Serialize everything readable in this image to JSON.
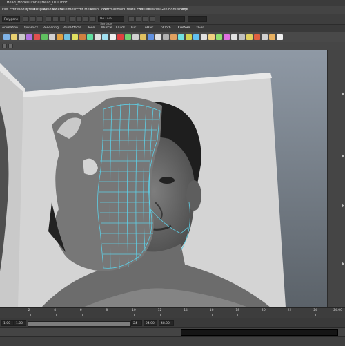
{
  "window": {
    "title": "...Head_ModelTutorial/Head_010.mb*"
  },
  "menu_bar": {
    "items": [
      "File",
      "Edit",
      "Modify",
      "Create",
      "Display",
      "Window",
      "Assets",
      "Select",
      "Mesh",
      "Edit Mesh",
      "Mesh Tools",
      "Normals",
      "Color",
      "Create UVs",
      "Edit UVs",
      "Muscle",
      "XGen",
      "Bonus Tools",
      "Help"
    ]
  },
  "status_line": {
    "mode": "Polygons",
    "no_live_surface": "No Live Surface"
  },
  "shelf_tabs": [
    "Animation",
    "Dynamics",
    "Rendering",
    "PaintEffects",
    "Toon",
    "Muscle",
    "Fluids",
    "Fur",
    "nHair",
    "nCloth",
    "Custom",
    "XGen"
  ],
  "active_shelf_tab": "Custom",
  "shelf_icon_colors": [
    "#7fb3e8",
    "#e8d070",
    "#c8c8c8",
    "#b070e0",
    "#e05050",
    "#5fc060",
    "#d0d0d0",
    "#e0a040",
    "#70c0e0",
    "#e0e060",
    "#d08040",
    "#60e0a0",
    "#e0e0e0",
    "#a0e0f0",
    "#f0f0f0",
    "#e04040",
    "#70d070",
    "#d0d0d0",
    "#e0c060",
    "#6090e0",
    "#e0e0e0",
    "#b0b0b0",
    "#e0a060",
    "#70e0e0",
    "#d0d050",
    "#60c0f0",
    "#e0e0e0",
    "#f0d080",
    "#90e070",
    "#e070e0",
    "#e0e0e0",
    "#c0c0c0",
    "#e0d060",
    "#e06040",
    "#d0d0d0",
    "#e8b060",
    "#f0f0f0"
  ],
  "time_slider": {
    "ticks": [
      "2",
      "4",
      "6",
      "8",
      "10",
      "12",
      "14",
      "16",
      "18",
      "20",
      "22",
      "24"
    ],
    "end_label": "24.00"
  },
  "range_slider": {
    "start": "1.00",
    "current": "1.00",
    "end_frame": "24",
    "range_end": "24.00",
    "range_max": "48.00",
    "range_position": 0.5
  },
  "colors": {
    "wireframe": "#5ecfe6",
    "mesh": "#7a7a7a",
    "ui_dark": "#3b3b3b"
  }
}
